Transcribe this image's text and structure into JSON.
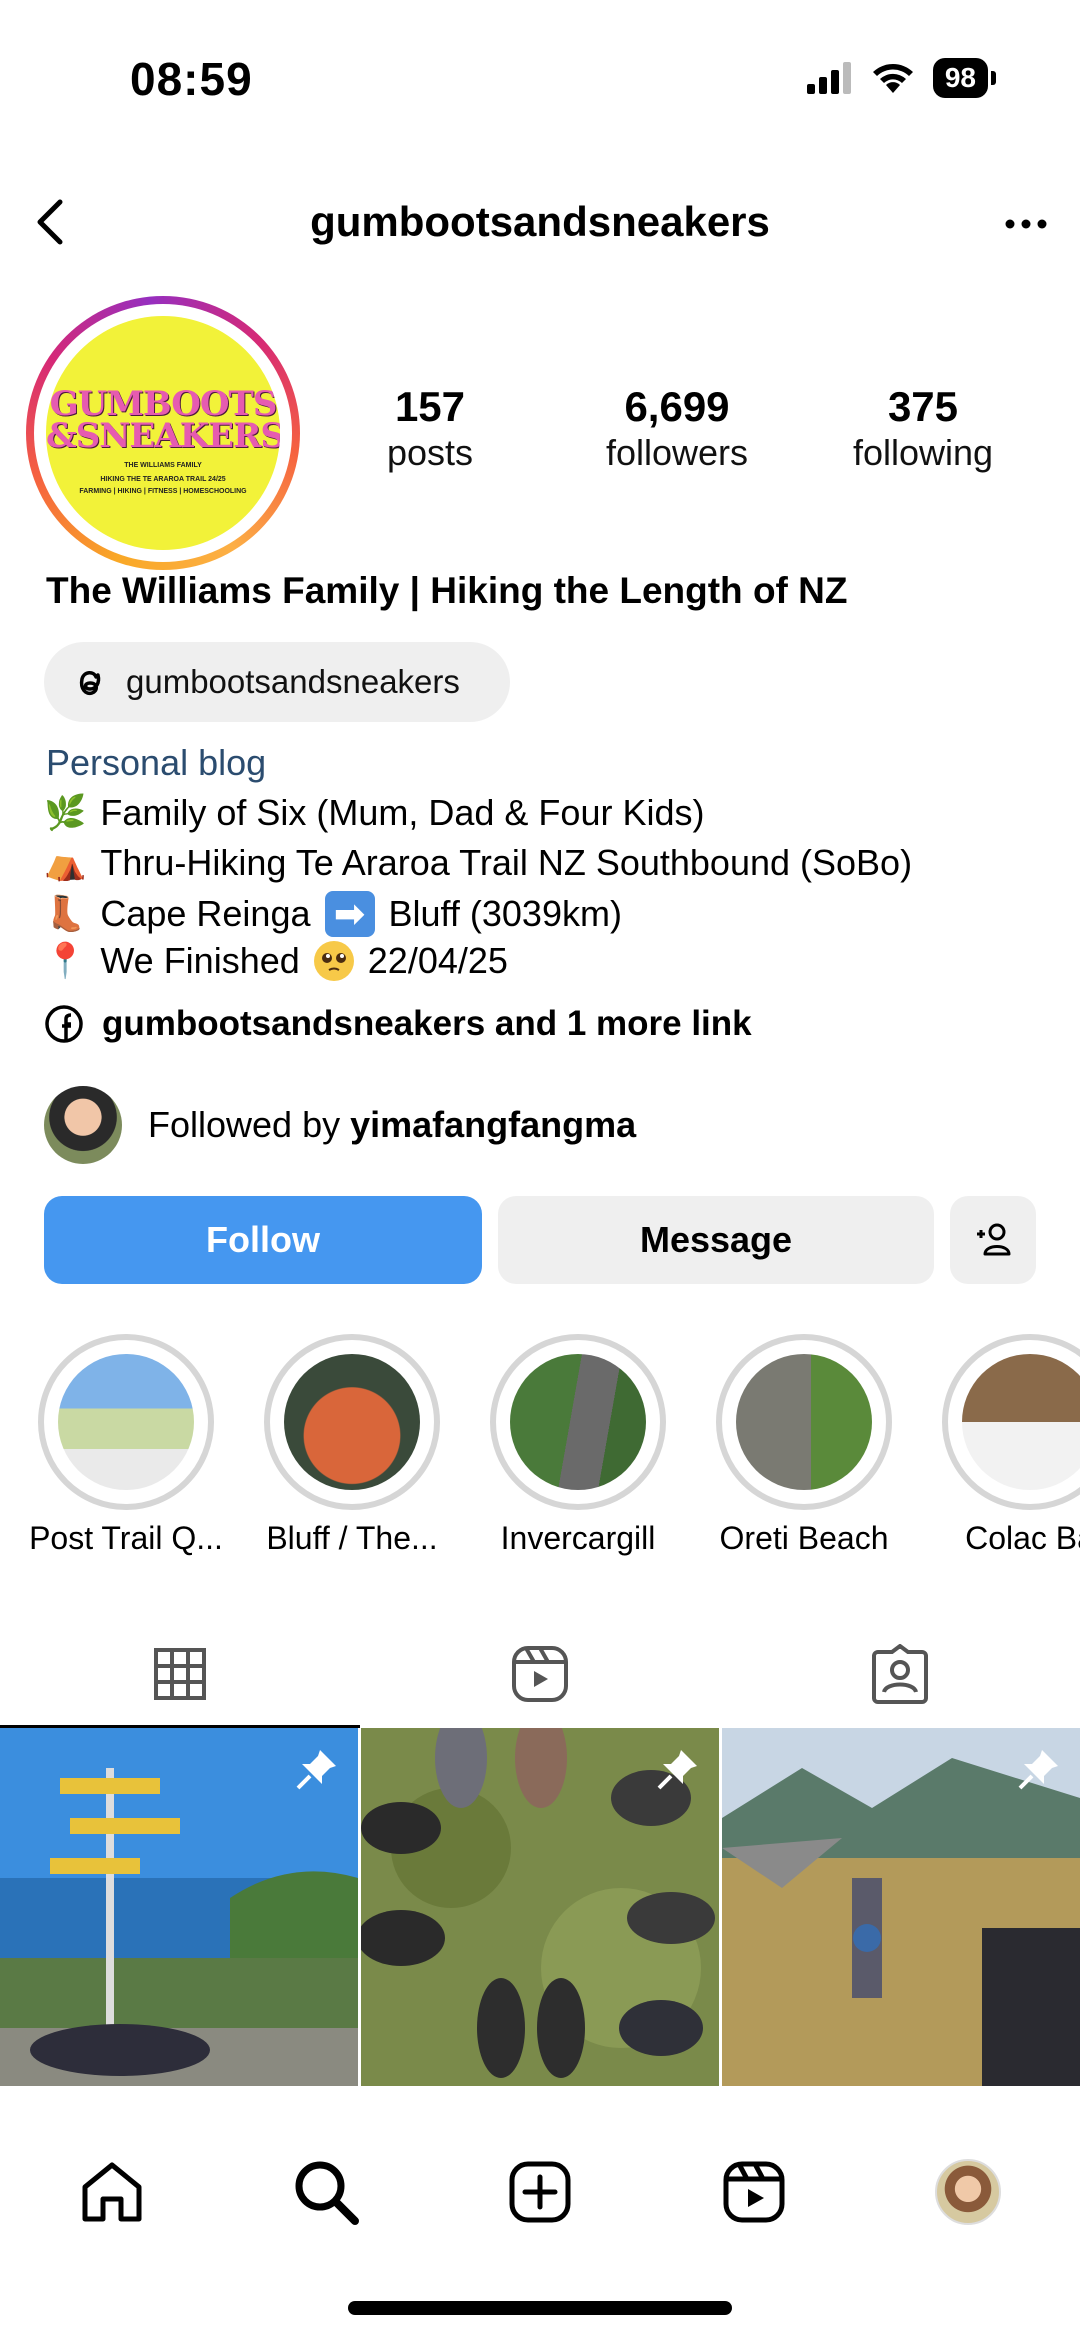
{
  "status_bar": {
    "time": "08:59",
    "battery": "98"
  },
  "header": {
    "username": "gumbootsandsneakers"
  },
  "avatar": {
    "logo_line1": "GUMBOOTS",
    "logo_line2": "&SNEAKERS",
    "logo_sub1": "THE WILLIAMS FAMILY",
    "logo_sub2": "HIKING THE TE ARAROA TRAIL 24/25",
    "logo_sub3": "FARMING | HIKING | FITNESS | HOMESCHOOLING"
  },
  "stats": [
    {
      "value": "157",
      "label": "posts"
    },
    {
      "value": "6,699",
      "label": "followers"
    },
    {
      "value": "375",
      "label": "following"
    }
  ],
  "profile": {
    "display_name": "The Williams Family | Hiking the Length of NZ",
    "threads_handle": "gumbootsandsneakers",
    "category": "Personal blog",
    "bio": [
      {
        "emoji": "🌿",
        "text": "Family of Six (Mum, Dad & Four Kids)"
      },
      {
        "emoji": "⛺",
        "text": "Thru-Hiking Te Araroa Trail NZ Southbound (SoBo)"
      },
      {
        "emoji": "👢",
        "text_a": "Cape Reinga",
        "arrow": "➡",
        "text_b": "Bluff (3039km)"
      },
      {
        "emoji": "📍",
        "text_a": "We Finished",
        "text_b": "22/04/25"
      }
    ],
    "links_text": "gumbootsandsneakers and 1 more link",
    "followed_by_prefix": "Followed by",
    "followed_by_user": "yimafangfangma"
  },
  "buttons": {
    "follow": "Follow",
    "message": "Message"
  },
  "highlights": [
    {
      "label": "Post Trail Q..."
    },
    {
      "label": "Bluff / The..."
    },
    {
      "label": "Invercargill"
    },
    {
      "label": "Oreti Beach"
    },
    {
      "label": "Colac Ba"
    }
  ],
  "colors": {
    "follow_blue": "#4597f0",
    "category_blue": "#2b4c6f",
    "pill_gray": "#efefef"
  }
}
